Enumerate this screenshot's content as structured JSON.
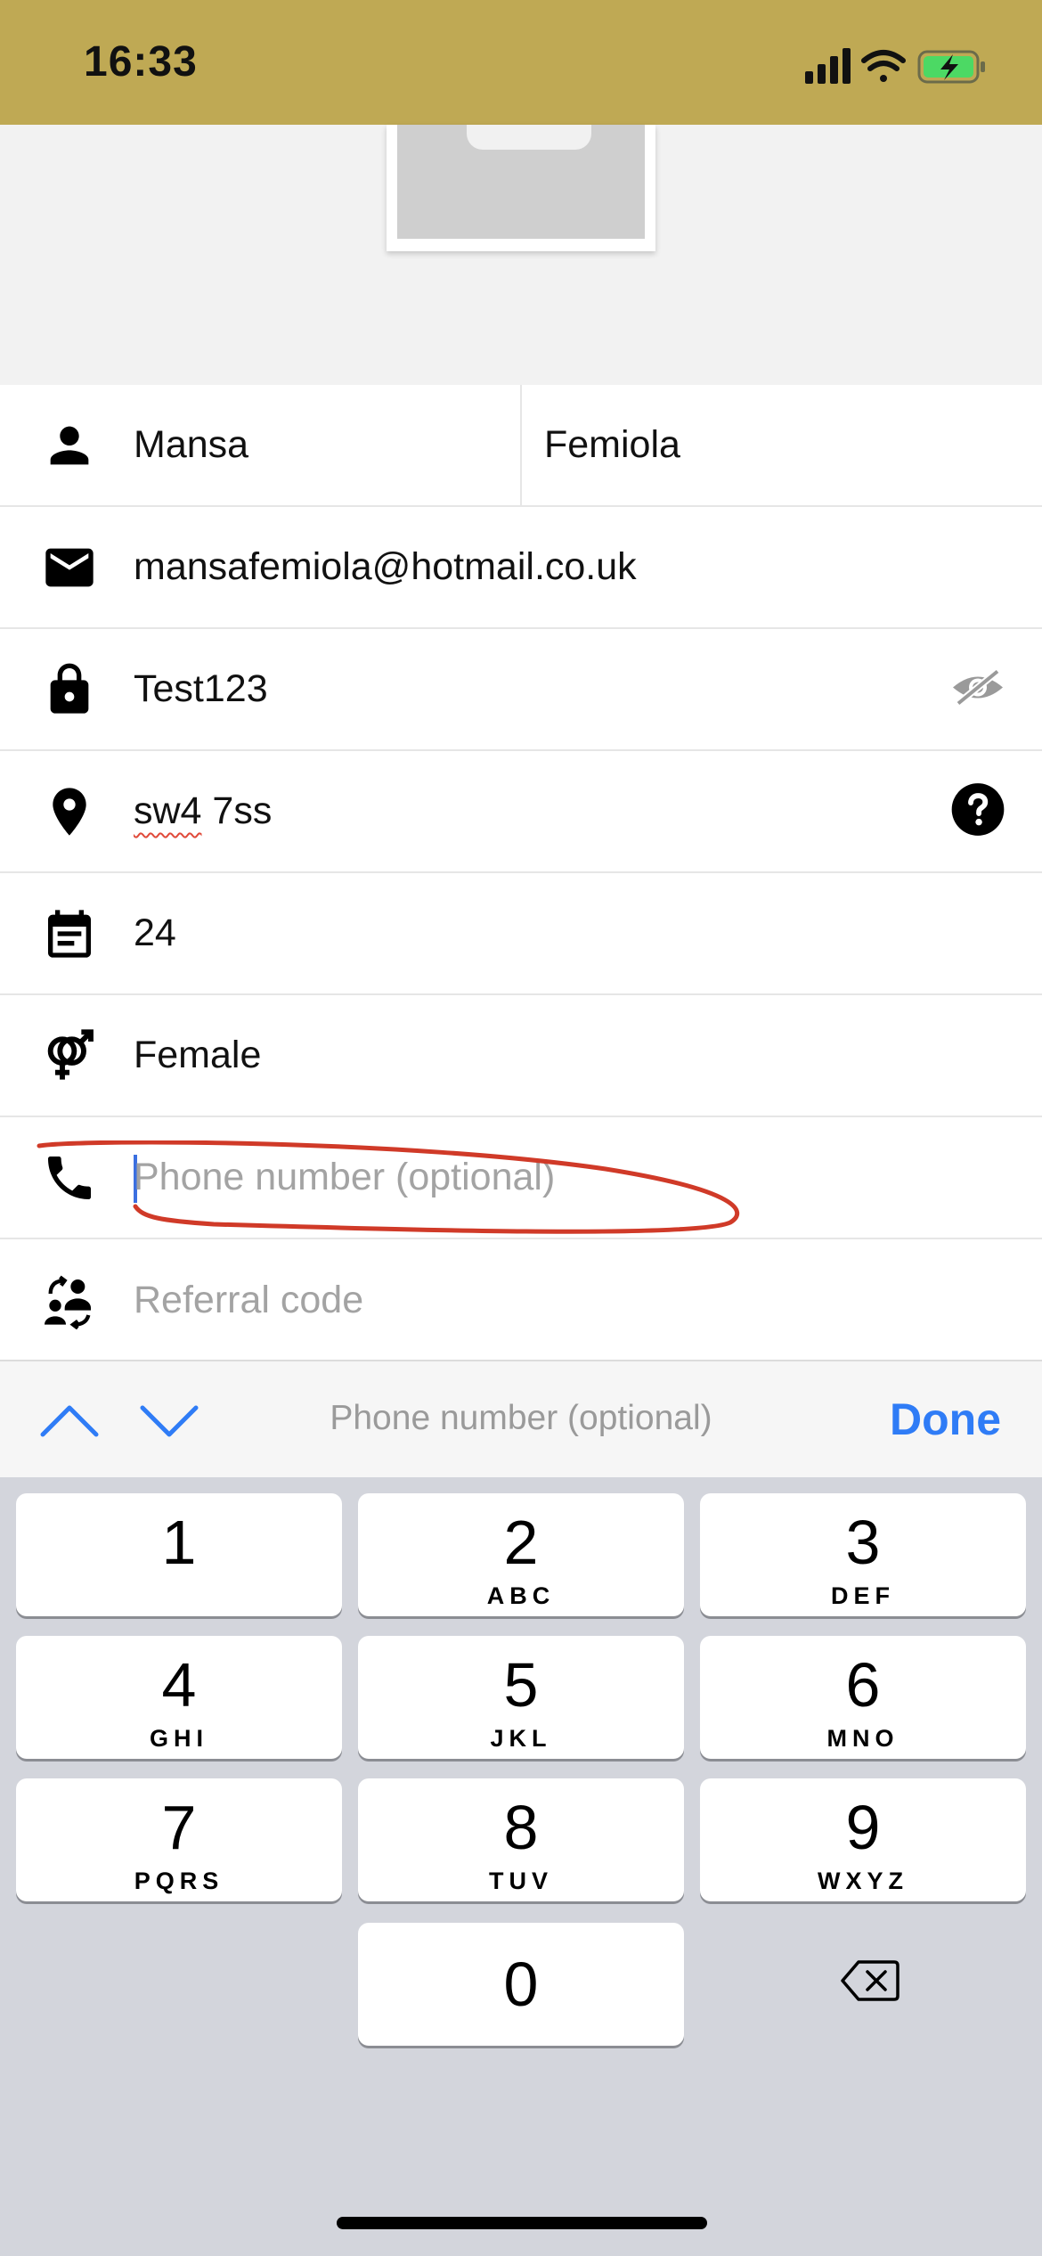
{
  "status_bar": {
    "time": "16:33"
  },
  "form": {
    "first_name": "Mansa",
    "last_name": "Femiola",
    "email": "mansafemiola@hotmail.co.uk",
    "password": "Test123",
    "postcode_part1": "sw4",
    "postcode_part2": " 7ss",
    "age": "24",
    "gender": "Female",
    "phone_placeholder": "Phone number (optional)",
    "referral_placeholder": "Referral code"
  },
  "accessory_bar": {
    "field_label": "Phone number (optional)",
    "done_label": "Done"
  },
  "keypad": {
    "keys": [
      {
        "digit": "1",
        "letters": ""
      },
      {
        "digit": "2",
        "letters": "ABC"
      },
      {
        "digit": "3",
        "letters": "DEF"
      },
      {
        "digit": "4",
        "letters": "GHI"
      },
      {
        "digit": "5",
        "letters": "JKL"
      },
      {
        "digit": "6",
        "letters": "MNO"
      },
      {
        "digit": "7",
        "letters": "PQRS"
      },
      {
        "digit": "8",
        "letters": "TUV"
      },
      {
        "digit": "9",
        "letters": "WXYZ"
      },
      {
        "digit": "0",
        "letters": ""
      }
    ]
  },
  "colors": {
    "status_bar": "#bfa954",
    "accent": "#2f7cf6",
    "annotation": "#d03a28"
  }
}
